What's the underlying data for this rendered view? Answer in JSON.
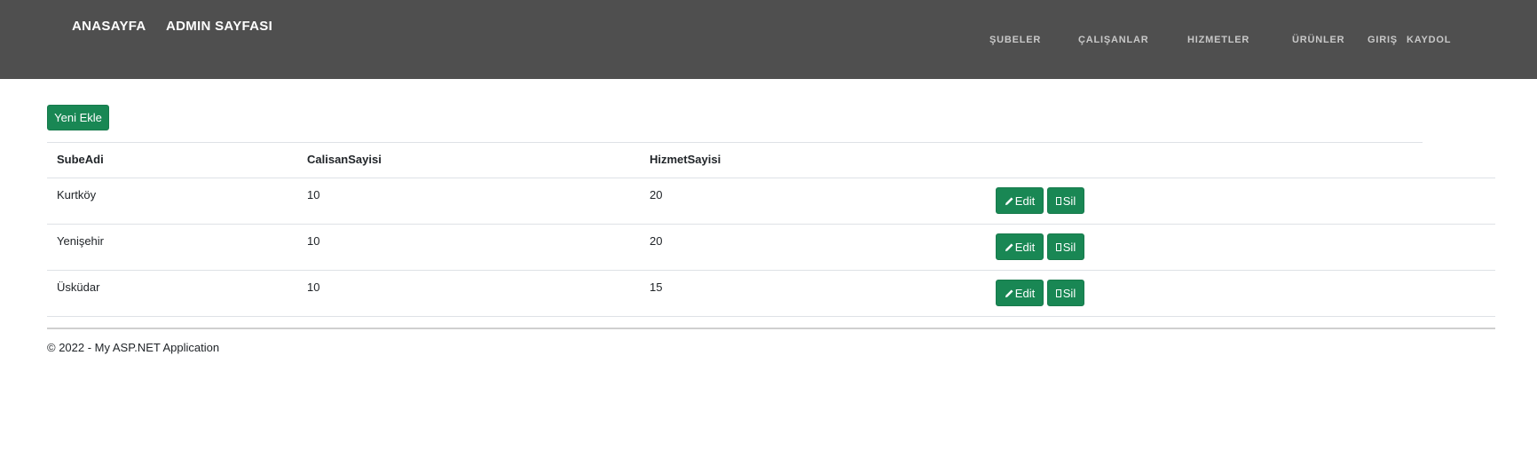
{
  "nav": {
    "left": [
      "ANASAYFA",
      "ADMIN SAYFASI"
    ],
    "right": [
      "ŞUBELER",
      "ÇALIŞANLAR",
      "HIZMETLER",
      "ÜRÜNLER",
      "GIRIŞ",
      "KAYDOL"
    ]
  },
  "toolbar": {
    "add_label": "Yeni Ekle"
  },
  "table": {
    "headers": [
      "SubeAdi",
      "CalisanSayisi",
      "HizmetSayisi"
    ],
    "rows": [
      {
        "name": "Kurtköy",
        "employees": "10",
        "services": "20"
      },
      {
        "name": "Yenişehir",
        "employees": "10",
        "services": "20"
      },
      {
        "name": "Üsküdar",
        "employees": "10",
        "services": "15"
      }
    ],
    "edit_label": "Edit",
    "delete_label": "Sil"
  },
  "footer": {
    "text": "© 2022 - My ASP.NET Application"
  },
  "colors": {
    "navbar": "#4f4f4f",
    "button": "#198754"
  }
}
